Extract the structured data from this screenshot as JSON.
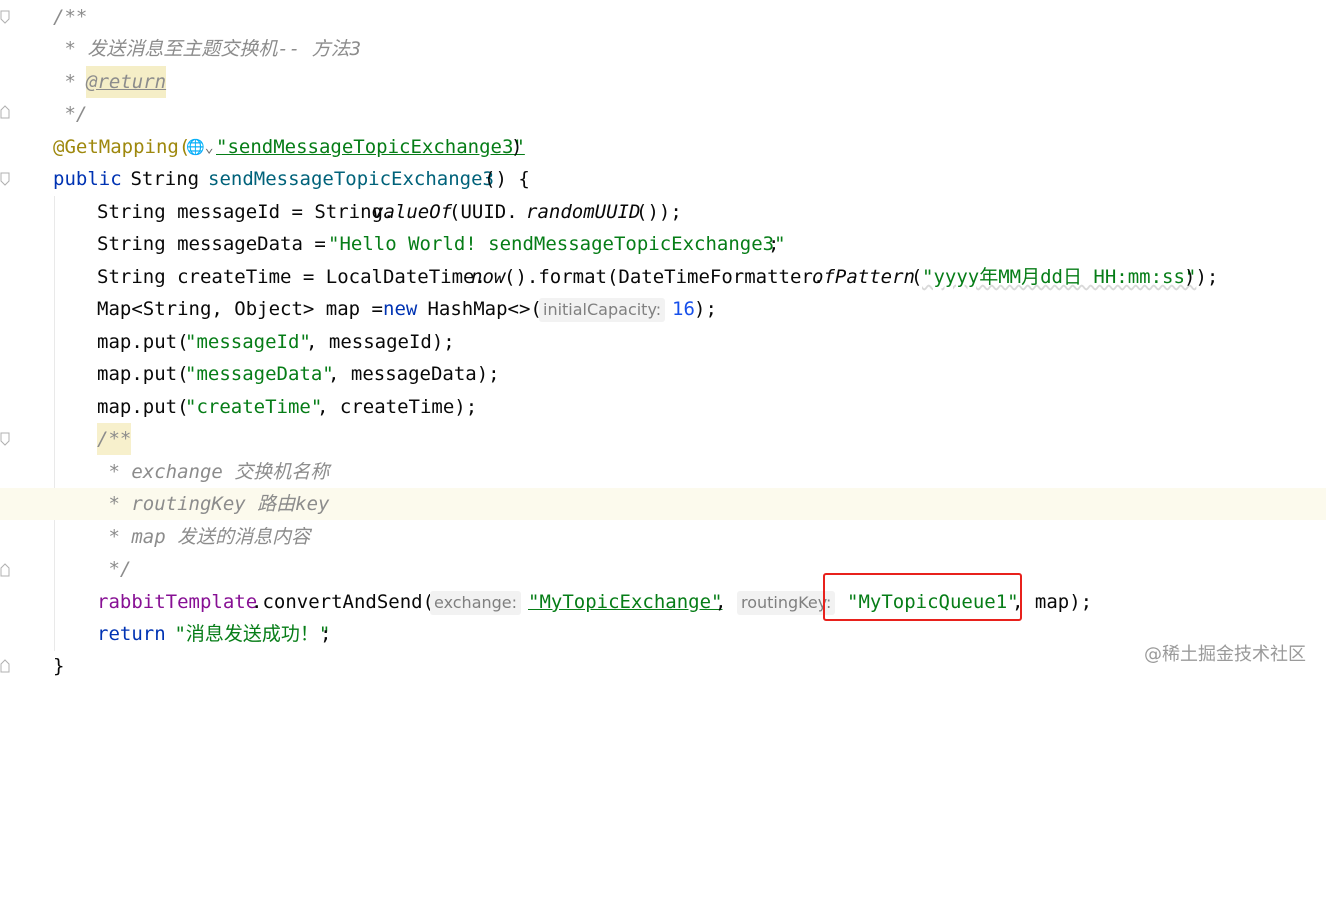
{
  "code": {
    "l1": "/**",
    "l2": " * 发送消息至主题交换机-- 方法3",
    "l3_prefix": " * ",
    "l3_tag": "@return",
    "l4": " */",
    "l5_ann": "@GetMapping(",
    "l5_icons": "🌐⌄",
    "l5_str": "\"sendMessageTopicExchange3\"",
    "l5_close": ")",
    "l6_kw": "public",
    "l6_type": " String ",
    "l6_method": "sendMessageTopicExchange3",
    "l6_rest": "() {",
    "l7_a": "String messageId = String.",
    "l7_b": "valueOf",
    "l7_c": "(UUID.",
    "l7_d": "randomUUID",
    "l7_e": "());",
    "l8_a": "String messageData = ",
    "l8_str": "\"Hello World! sendMessageTopicExchange3\"",
    "l8_end": ";",
    "l9_a": "String createTime = LocalDateTime.",
    "l9_b": "now",
    "l9_c": "().format(DateTimeFormatter.",
    "l9_d": "ofPattern",
    "l9_e": "(",
    "l9_str": "\"yyyy年MM月dd日 HH:mm:ss\"",
    "l9_end": "));",
    "l10_a": "Map<String, Object> map = ",
    "l10_kw": "new",
    "l10_b": " HashMap<>(",
    "l10_hint": "initialCapacity:",
    "l10_num": "16",
    "l10_end": ");",
    "l11_a": "map.put(",
    "l11_str": "\"messageId\"",
    "l11_b": ", messageId);",
    "l12_a": "map.put(",
    "l12_str": "\"messageData\"",
    "l12_b": ", messageData);",
    "l13_a": "map.put(",
    "l13_str": "\"createTime\"",
    "l13_b": ", createTime);",
    "l14": "/**",
    "l15": " * exchange 交换机名称",
    "l16": " * routingKey 路由key",
    "l17": " * map 发送的消息内容",
    "l18": " */",
    "l19_field": "rabbitTemplate",
    "l19_a": ".convertAndSend(",
    "l19_hint1": "exchange:",
    "l19_str1": "\"MyTopicExchange\"",
    "l19_comma": ",",
    "l19_hint2": "routingKey:",
    "l19_str2": "\"MyTopicQueue1\"",
    "l19_end": ", map);",
    "l20_kw": "return",
    "l20_str": " \"消息发送成功！\"",
    "l20_end": ";",
    "l21": "}"
  },
  "watermark": "@稀土掘金技术社区",
  "colors": {
    "keyword": "#0033b3",
    "string": "#067d17",
    "comment": "#8c8c8c",
    "annotation": "#9e880d",
    "field": "#871094",
    "highlight_box": "#e8211c"
  }
}
